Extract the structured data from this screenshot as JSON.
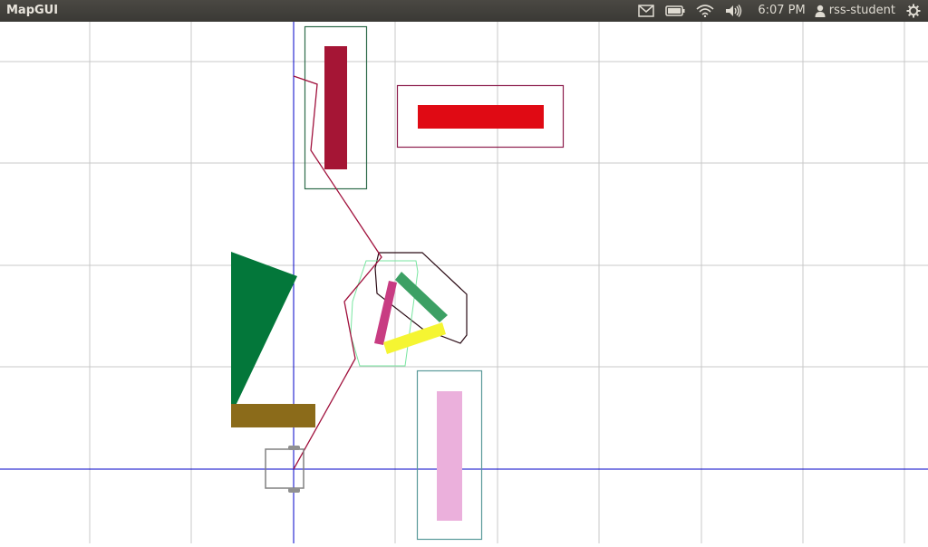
{
  "app": {
    "title": "MapGUI"
  },
  "tray": {
    "mail_icon": "mail-icon",
    "battery_icon": "battery-icon",
    "wifi_icon": "wifi-icon",
    "volume_icon": "volume-icon",
    "clock": "6:07 PM",
    "user_icon": "user-icon",
    "user_name": "rss-student",
    "settings_icon": "gear-icon"
  },
  "map": {
    "colors": {
      "grid": "#c8c8c8",
      "axis": "#0000c8",
      "path": "#a0103c",
      "obstacle_tall_red": "#a51535",
      "obstacle_wide_red": "#e00a14",
      "obstacle_green_triangle": "#03773a",
      "obstacle_olive": "#8b6b1a",
      "obstacle_pink": "#ebb0dc",
      "obstacle_magenta": "#c83c82",
      "obstacle_teal_green": "#3ca064",
      "obstacle_yellow": "#f5f532",
      "hull_dark_green": "#2e6b4a",
      "hull_maroon": "#8c1c4c",
      "hull_black": "#2a0a14",
      "hull_light_green": "#78e6a0",
      "hull_teal": "#5a9a9a",
      "robot": "#808080"
    }
  }
}
